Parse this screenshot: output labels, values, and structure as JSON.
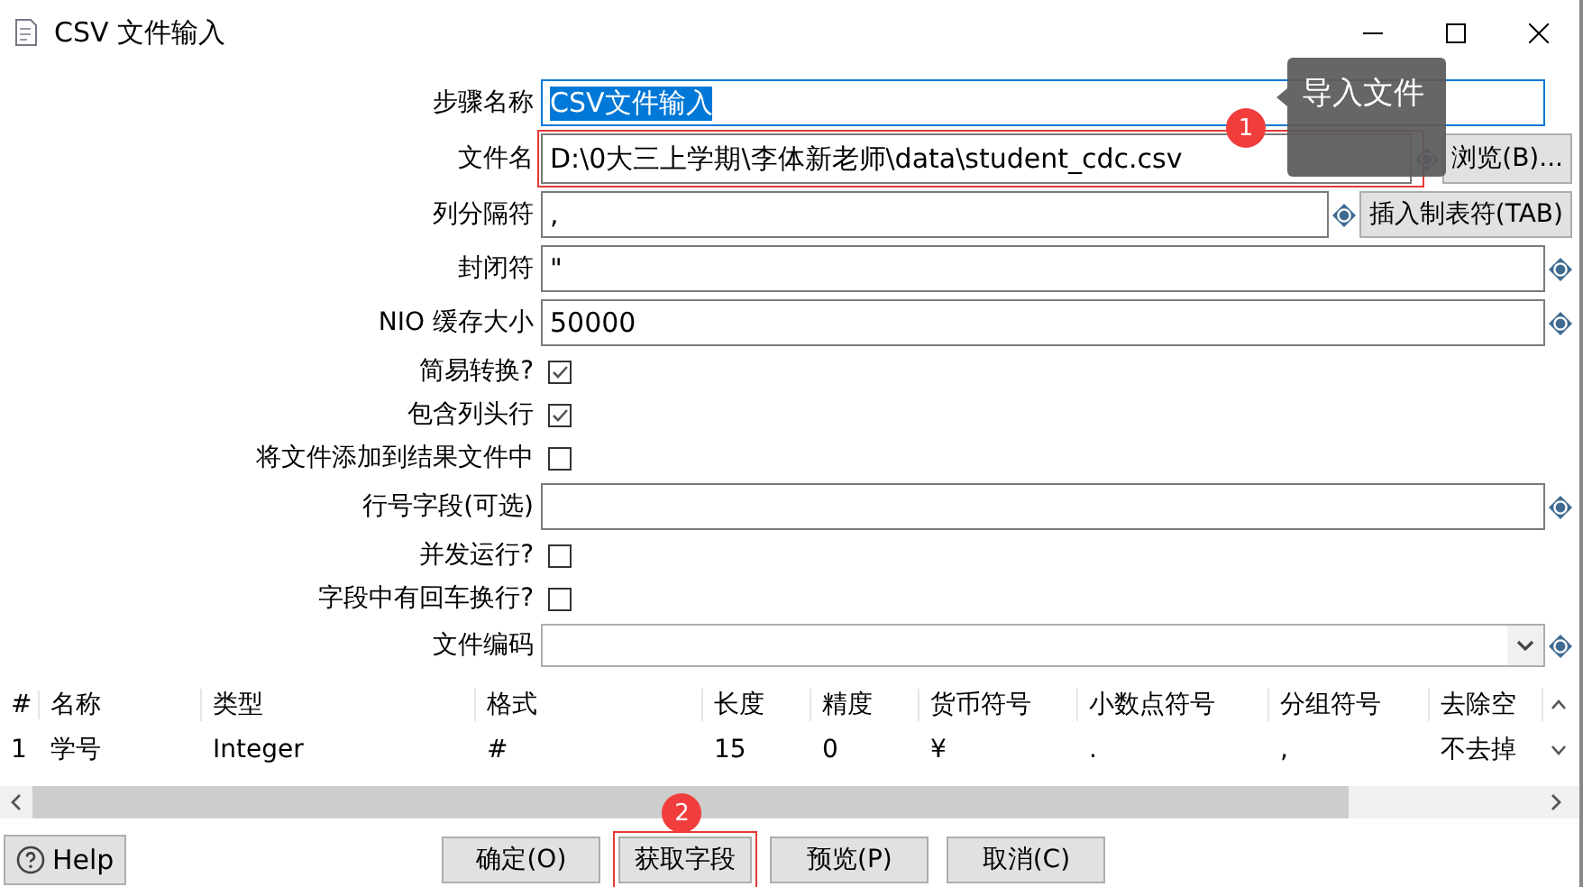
{
  "window": {
    "title": "CSV 文件输入"
  },
  "fields": [
    {
      "kind": "text",
      "label": "步骤名称",
      "value": "CSV文件输入",
      "value_selected": true,
      "variable_icon": false
    },
    {
      "kind": "file",
      "label": "文件名",
      "value": "D:\\0大三上学期\\李体新老师\\data\\student_cdc.csv",
      "button": "浏览(B)...",
      "highlighted": true,
      "marker": "1",
      "tooltip": "导入文件",
      "variable_icon": true
    },
    {
      "kind": "button_text",
      "label": "列分隔符",
      "value": ",",
      "button": "插入制表符(TAB)",
      "variable_icon": true
    },
    {
      "kind": "text",
      "label": "封闭符",
      "value": "\"",
      "value_selected": false,
      "variable_icon": true
    },
    {
      "kind": "text",
      "label": "NIO 缓存大小",
      "value": "50000",
      "value_selected": false,
      "variable_icon": true
    },
    {
      "kind": "checkbox",
      "label": "简易转换?",
      "checked": true
    },
    {
      "kind": "checkbox",
      "label": "包含列头行",
      "checked": true
    },
    {
      "kind": "checkbox",
      "label": "将文件添加到结果文件中",
      "checked": false
    },
    {
      "kind": "text",
      "label": "行号字段(可选)",
      "value_selected": false,
      "variable_icon": true
    },
    {
      "kind": "checkbox",
      "label": "并发运行?",
      "checked": false
    },
    {
      "kind": "checkbox",
      "label": "字段中有回车换行?",
      "checked": false
    },
    {
      "kind": "combo",
      "label": "文件编码",
      "variable_icon": true
    }
  ],
  "table": {
    "columns": [
      "#",
      "名称",
      "类型",
      "格式",
      "长度",
      "精度",
      "货币符号",
      "小数点符号",
      "分组符号",
      "去除空"
    ],
    "rows": [
      [
        "1",
        "学号",
        "Integer",
        "#",
        "15",
        "0",
        "¥",
        ".",
        ",",
        "不去掉"
      ]
    ]
  },
  "help_button": "Help",
  "buttons": [
    {
      "label": "确定(O)",
      "highlighted": false
    },
    {
      "label": "获取字段",
      "highlighted": true,
      "marker": "2"
    },
    {
      "label": "预览(P)",
      "highlighted": false
    },
    {
      "label": "取消(C)",
      "highlighted": false
    }
  ]
}
